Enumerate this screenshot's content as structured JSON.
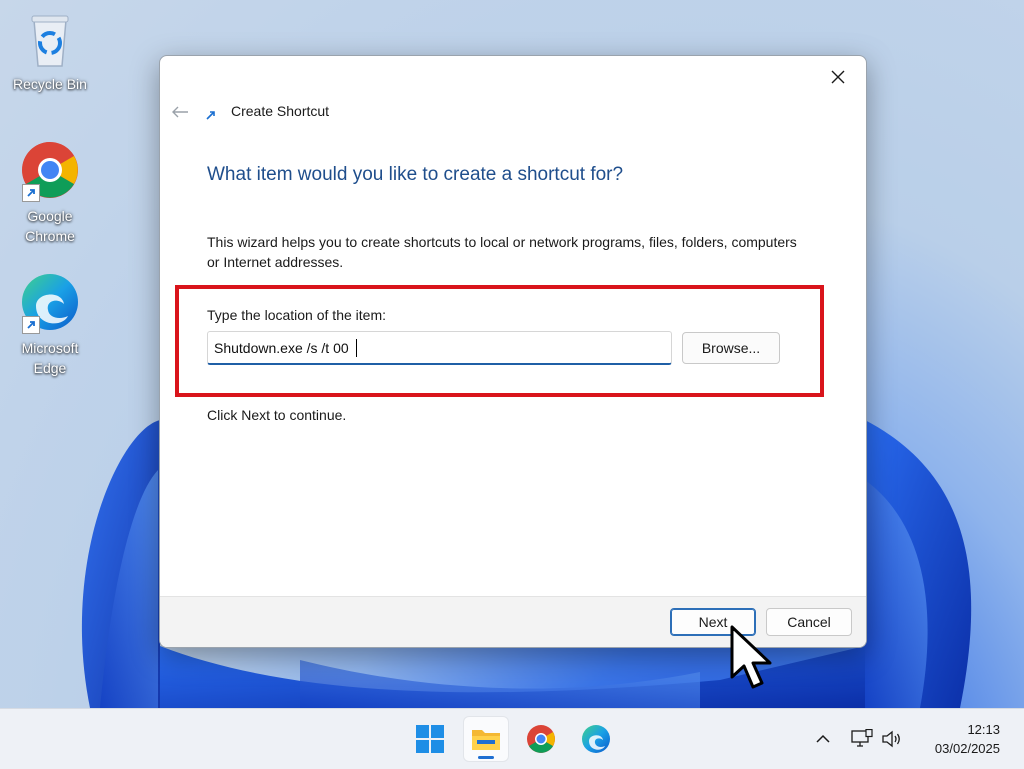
{
  "desktop": {
    "icons": [
      {
        "label": "Recycle Bin"
      },
      {
        "label": "Google Chrome"
      },
      {
        "label": "Microsoft Edge"
      }
    ]
  },
  "dialog": {
    "title": "Create Shortcut",
    "heading": "What item would you like to create a shortcut for?",
    "description": "This wizard helps you to create shortcuts to local or network programs, files, folders, computers or Internet addresses.",
    "location_label": "Type the location of the item:",
    "location_value": "Shutdown.exe /s /t 00",
    "browse_label": "Browse...",
    "continue_text": "Click Next to continue.",
    "next_label": "Next",
    "cancel_label": "Cancel",
    "highlight_color": "#d9141b"
  },
  "taskbar": {
    "icons": [
      "windows-start-icon",
      "file-explorer-icon",
      "chrome-icon",
      "edge-icon"
    ],
    "tray_icons": [
      "chevron-up-icon",
      "network-icon",
      "speaker-icon"
    ],
    "time": "12:13",
    "date": "03/02/2025"
  }
}
